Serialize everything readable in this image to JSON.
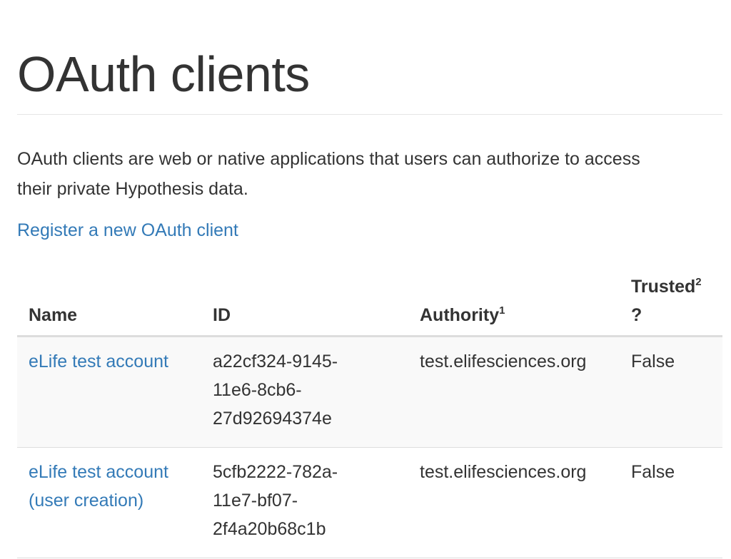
{
  "page": {
    "title": "OAuth clients",
    "intro_line1": "OAuth clients are web or native applications that users can authorize to access",
    "intro_line2": "their private Hypothesis data.",
    "register_link": "Register a new OAuth client"
  },
  "table": {
    "headers": {
      "name": "Name",
      "id": "ID",
      "authority": "Authority",
      "authority_note": "1",
      "trusted": "Trusted",
      "trusted_note": "2",
      "trusted_suffix": "?"
    },
    "rows": [
      {
        "name": "eLife test account",
        "id_lines": [
          "a22cf324-9145-",
          "11e6-8cb6-",
          "27d92694374e"
        ],
        "authority": "test.elifesciences.org",
        "trusted": "False"
      },
      {
        "name_lines": [
          "eLife test account",
          "(user creation)"
        ],
        "id_lines": [
          "5cfb2222-782a-",
          "11e7-bf07-",
          "2f4a20b68c1b"
        ],
        "authority": "test.elifesciences.org",
        "trusted": "False"
      }
    ]
  },
  "colors": {
    "link": "#337ab7",
    "text": "#333333",
    "stripe": "#f9f9f9",
    "border": "#dddddd"
  }
}
